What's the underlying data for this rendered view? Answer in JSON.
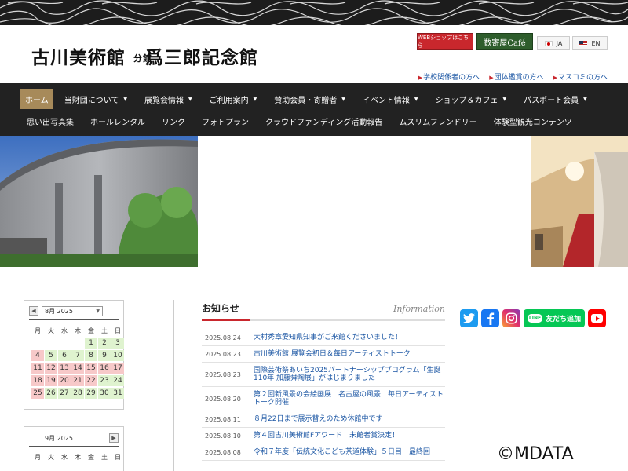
{
  "header": {
    "logo_main": "古川美術館",
    "logo_bunkan": "分館",
    "logo_sub": "爲三郎記念館",
    "shop_web_label": "WEBショップはこちら",
    "shop_cafe_label": "数寄屋Café",
    "lang_ja": "JA",
    "lang_en": "EN",
    "sublinks": [
      "学校関係者の方へ",
      "団体鑑賞の方へ",
      "マスコミの方へ"
    ]
  },
  "nav": {
    "row1": [
      {
        "label": "ホーム",
        "active": true,
        "dropdown": false
      },
      {
        "label": "当財団について",
        "dropdown": true
      },
      {
        "label": "展覧会情報",
        "dropdown": true
      },
      {
        "label": "ご利用案内",
        "dropdown": true
      },
      {
        "label": "賛助会員・寄贈者",
        "dropdown": true
      },
      {
        "label": "イベント情報",
        "dropdown": true
      },
      {
        "label": "ショップ＆カフェ",
        "dropdown": true
      },
      {
        "label": "パスポート会員",
        "dropdown": true
      }
    ],
    "row2": [
      "思い出写真集",
      "ホールレンタル",
      "リンク",
      "フォトプラン",
      "クラウドファンディング活動報告",
      "ムスリムフレンドリー",
      "体験型観光コンテンツ"
    ]
  },
  "calendar1": {
    "selected_month": "8月 2025",
    "weekdays": [
      "月",
      "火",
      "水",
      "木",
      "金",
      "土",
      "日"
    ],
    "weeks": [
      [
        {
          "d": "",
          "s": ""
        },
        {
          "d": "",
          "s": ""
        },
        {
          "d": "",
          "s": ""
        },
        {
          "d": "",
          "s": ""
        },
        {
          "d": "1",
          "s": "green"
        },
        {
          "d": "2",
          "s": "green"
        },
        {
          "d": "3",
          "s": "green"
        }
      ],
      [
        {
          "d": "4",
          "s": "pink"
        },
        {
          "d": "5",
          "s": "green"
        },
        {
          "d": "6",
          "s": "green"
        },
        {
          "d": "7",
          "s": "green"
        },
        {
          "d": "8",
          "s": "green"
        },
        {
          "d": "9",
          "s": "green"
        },
        {
          "d": "10",
          "s": "green"
        }
      ],
      [
        {
          "d": "11",
          "s": "pink"
        },
        {
          "d": "12",
          "s": "pink"
        },
        {
          "d": "13",
          "s": "pink"
        },
        {
          "d": "14",
          "s": "pink"
        },
        {
          "d": "15",
          "s": "pink"
        },
        {
          "d": "16",
          "s": "pink"
        },
        {
          "d": "17",
          "s": "pink"
        }
      ],
      [
        {
          "d": "18",
          "s": "pink"
        },
        {
          "d": "19",
          "s": "pink"
        },
        {
          "d": "20",
          "s": "pink"
        },
        {
          "d": "21",
          "s": "pink"
        },
        {
          "d": "22",
          "s": "pink"
        },
        {
          "d": "23",
          "s": "green"
        },
        {
          "d": "24",
          "s": "green"
        }
      ],
      [
        {
          "d": "25",
          "s": "pink"
        },
        {
          "d": "26",
          "s": "green"
        },
        {
          "d": "27",
          "s": "green"
        },
        {
          "d": "28",
          "s": "green"
        },
        {
          "d": "29",
          "s": "green"
        },
        {
          "d": "30",
          "s": "green"
        },
        {
          "d": "31",
          "s": "green"
        }
      ]
    ]
  },
  "calendar2": {
    "title": "9月 2025",
    "weekdays": [
      "月",
      "火",
      "水",
      "木",
      "金",
      "土",
      "日"
    ]
  },
  "news": {
    "title": "お知らせ",
    "title_en": "Information",
    "items": [
      {
        "date": "2025.08.24",
        "text": "大村秀章愛知県知事がご来館くださいました！"
      },
      {
        "date": "2025.08.23",
        "text": "古川美術館 展覧会初日＆毎日アーティストトーク"
      },
      {
        "date": "2025.08.23",
        "text": "国際芸術祭あいち2025パートナーシッププログラム「生誕110年 加藤舜陶展」がはじまりました"
      },
      {
        "date": "2025.08.20",
        "text": "第２回新風景の会絵画展　名古屋の風景　毎日アーティストトーク開催"
      },
      {
        "date": "2025.08.11",
        "text": "８月22日まで展示替えのため休館中です"
      },
      {
        "date": "2025.08.10",
        "text": "第４回古川美術館Fアワード　未館者賞決定！"
      },
      {
        "date": "2025.08.08",
        "text": "令和７年度「伝統文化こども茶道体験」５日目ー最終回"
      }
    ]
  },
  "social": {
    "line_label": "友だち追加",
    "line_badge": "LINE",
    "icons": [
      "twitter-icon",
      "facebook-icon",
      "instagram-icon",
      "line-icon",
      "youtube-icon"
    ]
  },
  "watermark": "©MDATA"
}
